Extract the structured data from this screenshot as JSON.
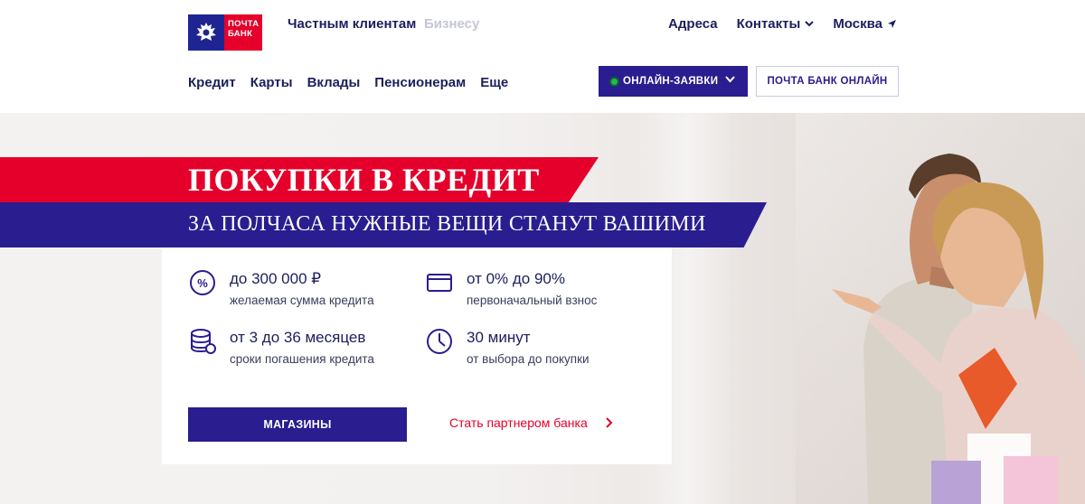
{
  "logo": {
    "line1": "ПОЧТА",
    "line2": "БАНК"
  },
  "header": {
    "segments": [
      "Частным клиентам",
      "Бизнесу"
    ],
    "links": [
      "Адреса",
      "Контакты",
      "Москва"
    ],
    "nav": [
      "Кредит",
      "Карты",
      "Вклады",
      "Пенсионерам",
      "Еще"
    ],
    "online_apps_label": "ОНЛАЙН-ЗАЯВКИ",
    "bank_online_label": "ПОЧТА БАНК ОНЛАЙН"
  },
  "hero": {
    "title": "ПОКУПКИ В КРЕДИТ",
    "subtitle": "ЗА ПОЛЧАСА НУЖНЫЕ ВЕЩИ СТАНУТ ВАШИМИ",
    "features": [
      {
        "icon": "percent-icon",
        "title": "до 300 000 ₽",
        "sub": "желаемая сумма кредита"
      },
      {
        "icon": "card-icon",
        "title": "от 0% до 90%",
        "sub": "первоначальный взнос"
      },
      {
        "icon": "coins-icon",
        "title": "от 3 до 36 месяцев",
        "sub": "сроки погашения кредита"
      },
      {
        "icon": "clock-icon",
        "title": "30 минут",
        "sub": "от выбора до покупки"
      }
    ],
    "stores_button": "МАГАЗИНЫ",
    "partner_link": "Стать партнером банка"
  },
  "colors": {
    "brand_blue": "#2a1d8f",
    "brand_red": "#e4002b",
    "text_dark": "#1b1f5e"
  }
}
